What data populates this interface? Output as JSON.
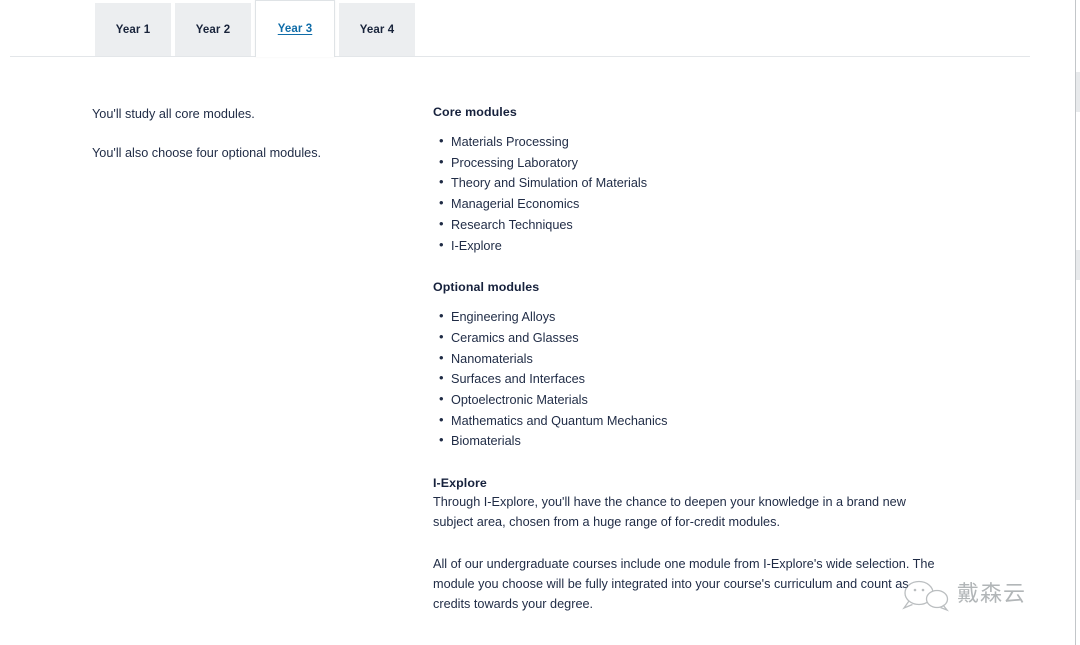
{
  "tabs": {
    "items": [
      {
        "label": "Year 1",
        "active": false
      },
      {
        "label": "Year 2",
        "active": false
      },
      {
        "label": "Year 3",
        "active": true
      },
      {
        "label": "Year 4",
        "active": false
      }
    ]
  },
  "left_column": {
    "paragraphs": [
      "You'll study all core modules.",
      "You'll also choose four optional modules."
    ]
  },
  "right_column": {
    "core": {
      "heading": "Core modules",
      "items": [
        "Materials Processing",
        "Processing Laboratory",
        "Theory and Simulation of Materials",
        "Managerial Economics",
        "Research Techniques",
        "I-Explore"
      ]
    },
    "optional": {
      "heading": "Optional modules",
      "items": [
        "Engineering Alloys",
        "Ceramics and Glasses",
        "Nanomaterials",
        "Surfaces and Interfaces",
        "Optoelectronic Materials",
        "Mathematics and Quantum Mechanics",
        "Biomaterials"
      ]
    },
    "iexplore": {
      "heading": "I-Explore",
      "paragraph_1": "Through I-Explore, you'll have the chance to deepen your knowledge in a brand new subject area, chosen from a huge range of for-credit modules.",
      "paragraph_2": "All of our undergraduate courses include one module from I-Explore's wide selection. The module you choose will be fully integrated into your course's curriculum and count as credits towards your degree."
    }
  },
  "watermark": {
    "text": "戴森云",
    "logo_icon": "wechat-bubble-icon"
  },
  "colors": {
    "text": "#1f2b45",
    "heading": "#16213c",
    "active_tab_link": "#0f6ca8",
    "tab_background": "#eceef0",
    "rule": "#e3e6e9"
  }
}
